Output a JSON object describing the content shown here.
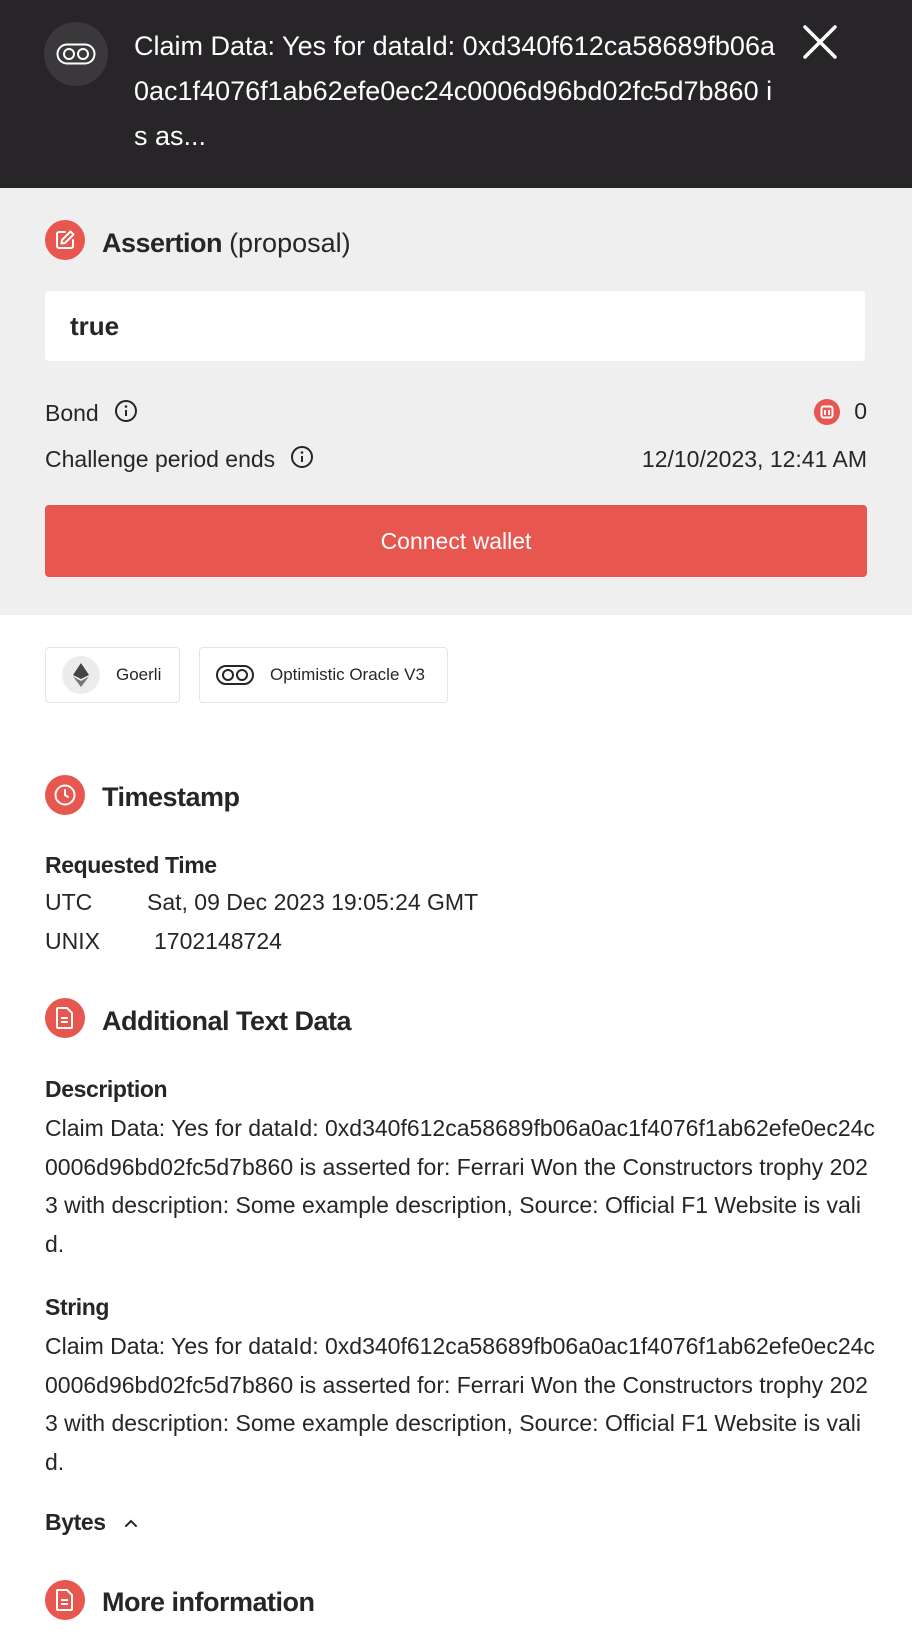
{
  "header": {
    "title": "Claim Data: Yes for dataId: 0xd340f612ca58689fb06a0ac1f4076f1ab62efe0ec24c0006d96bd02fc5d7b860 is as...",
    "icon": "oracle-icon",
    "close_icon": "close-icon"
  },
  "assertion": {
    "title": "Assertion",
    "subtitle": "(proposal)",
    "value": "true",
    "bond_label": "Bond",
    "bond_value": "0",
    "challenge_label": "Challenge period ends",
    "challenge_value": "12/10/2023, 12:41 AM",
    "connect_label": "Connect wallet"
  },
  "chips": {
    "network": "Goerli",
    "oracle": "Optimistic Oracle V3"
  },
  "timestamp": {
    "title": "Timestamp",
    "requested_label": "Requested Time",
    "utc_label": "UTC",
    "utc_value": "Sat, 09 Dec 2023 19:05:24 GMT",
    "unix_label": "UNIX",
    "unix_value": "1702148724"
  },
  "additional": {
    "title": "Additional Text Data",
    "description_label": "Description",
    "description_value": "Claim Data: Yes for dataId: 0xd340f612ca58689fb06a0ac1f4076f1ab62efe0ec24c0006d96bd02fc5d7b860 is asserted for: Ferrari Won the Constructors trophy 2023 with description: Some example description, Source: Official F1 Website is valid.",
    "string_label": "String",
    "string_value": "Claim Data: Yes for dataId: 0xd340f612ca58689fb06a0ac1f4076f1ab62efe0ec24c0006d96bd02fc5d7b860 is asserted for: Ferrari Won the Constructors trophy 2023 with description: Some example description, Source: Official F1 Website is valid.",
    "bytes_label": "Bytes"
  },
  "more": {
    "title": "More information"
  },
  "colors": {
    "accent": "#e8574f",
    "dark": "#272528",
    "panel": "#efefef"
  }
}
